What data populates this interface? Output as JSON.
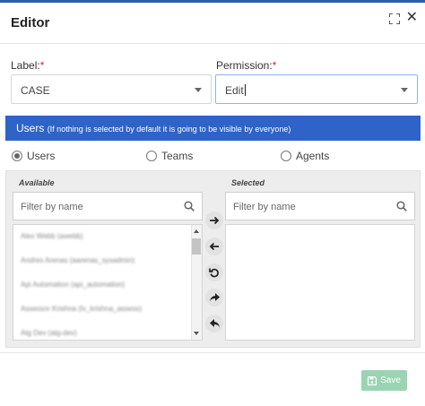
{
  "dialog": {
    "title": "Editor"
  },
  "label_field": {
    "label": "Label:",
    "required_mark": "*",
    "value": "CASE"
  },
  "permission_field": {
    "label": "Permission:",
    "required_mark": "*",
    "value": "Edit"
  },
  "banner": {
    "title": "Users",
    "note": "(If nothing is selected by default it is going to be visible by everyone)"
  },
  "radios": [
    {
      "label": "Users",
      "checked": true
    },
    {
      "label": "Teams",
      "checked": false
    },
    {
      "label": "Agents",
      "checked": false
    }
  ],
  "available": {
    "title": "Available",
    "filter_placeholder": "Filter by name",
    "items": [
      "Alex Webb (awebb)",
      "Andres Arenas (aarenas_sysadmin)",
      "Api Automation (api_automation)",
      "Assessor Krishna (lv_krishna_assess)",
      "Atg Dev (atg-dev)"
    ]
  },
  "selected": {
    "title": "Selected",
    "filter_placeholder": "Filter by name",
    "items": []
  },
  "footer": {
    "save_label": "Save"
  },
  "colors": {
    "accent": "#2e63c7",
    "save": "#9bd4b2",
    "required": "#d9232e"
  }
}
